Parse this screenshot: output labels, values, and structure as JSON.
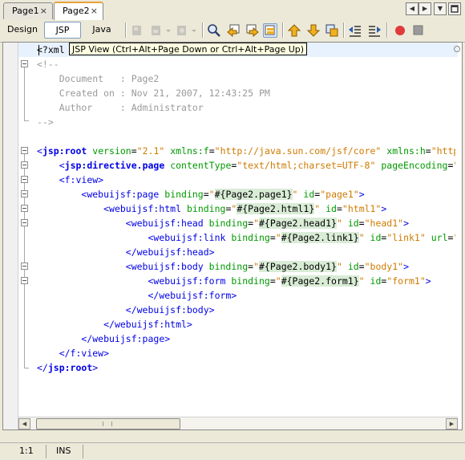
{
  "tabs": [
    {
      "label": "Page1",
      "active": false
    },
    {
      "label": "Page2",
      "active": true
    }
  ],
  "close_glyph": "×",
  "views": [
    {
      "label": "Design",
      "selected": false
    },
    {
      "label": "JSP",
      "selected": true
    },
    {
      "label": "Java",
      "selected": false
    }
  ],
  "tooltip": "JSP View (Ctrl+Alt+Page Down or Ctrl+Alt+Page Up)",
  "first_line": "<?xml",
  "comment": {
    "open": "<!--",
    "document": "    Document   : Page2",
    "created": "    Created on : Nov 21, 2007, 12:43:25 PM",
    "author": "    Author     : Administrator",
    "close": "-->"
  },
  "status": {
    "position": "1:1",
    "mode": "INS"
  },
  "icons": [
    "find-selection-icon",
    "find-previous-icon",
    "find-next-icon",
    "toggle-highlight-icon",
    "previous-bookmark-icon",
    "next-bookmark-icon",
    "toggle-bookmark-icon",
    "shift-left-icon",
    "shift-right-icon",
    "start-macro-icon",
    "stop-macro-icon"
  ]
}
